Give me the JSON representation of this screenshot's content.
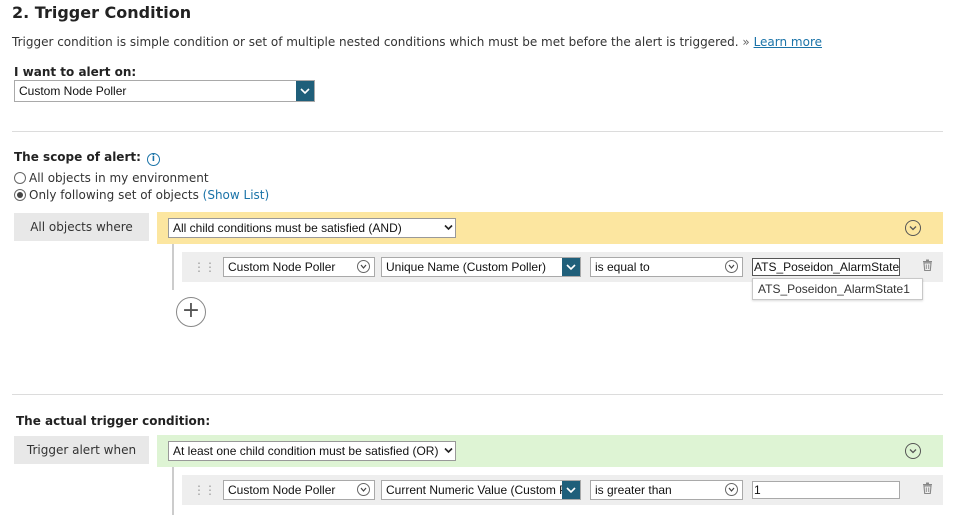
{
  "section": {
    "title": "2. Trigger Condition",
    "description": "Trigger condition is simple condition or set of multiple nested conditions which must be met before the alert is triggered.",
    "separator": "»",
    "learn_more": "Learn more"
  },
  "alert_on": {
    "label": "I want to alert on:",
    "value": "Custom Node Poller"
  },
  "scope": {
    "label": "The scope of alert:",
    "options": [
      "All objects in my environment",
      "Only following set of objects"
    ],
    "show_list": "(Show List)",
    "selected_index": 1
  },
  "scope_group": {
    "left_label": "All objects where",
    "operator": "All child conditions must be satisfied (AND)",
    "condition": {
      "object": "Custom Node Poller",
      "field": "Unique Name (Custom Poller)",
      "comparator": "is equal to",
      "value": "ATS_Poseidon_AlarmState",
      "suggestion": "ATS_Poseidon_AlarmState1"
    },
    "add_symbol": "+"
  },
  "trigger": {
    "label": "The actual trigger condition:",
    "left_label": "Trigger alert when",
    "operator": "At least one child condition must be satisfied (OR)",
    "condition": {
      "object": "Custom Node Poller",
      "field": "Current Numeric Value (Custom Poller)",
      "comparator": "is greater than",
      "value": "1"
    }
  },
  "icons": {
    "dropdown": "chevron-down-icon",
    "collapse": "circle-chevron-icon",
    "drag": "drag-handle-icon",
    "delete": "trash-icon",
    "info": "info-icon",
    "add": "plus-circle-icon"
  },
  "colors": {
    "and_band": "#fce6a0",
    "or_band": "#def4d4",
    "dropdown_accent": "#1f5f7a",
    "link": "#1a73a8"
  }
}
